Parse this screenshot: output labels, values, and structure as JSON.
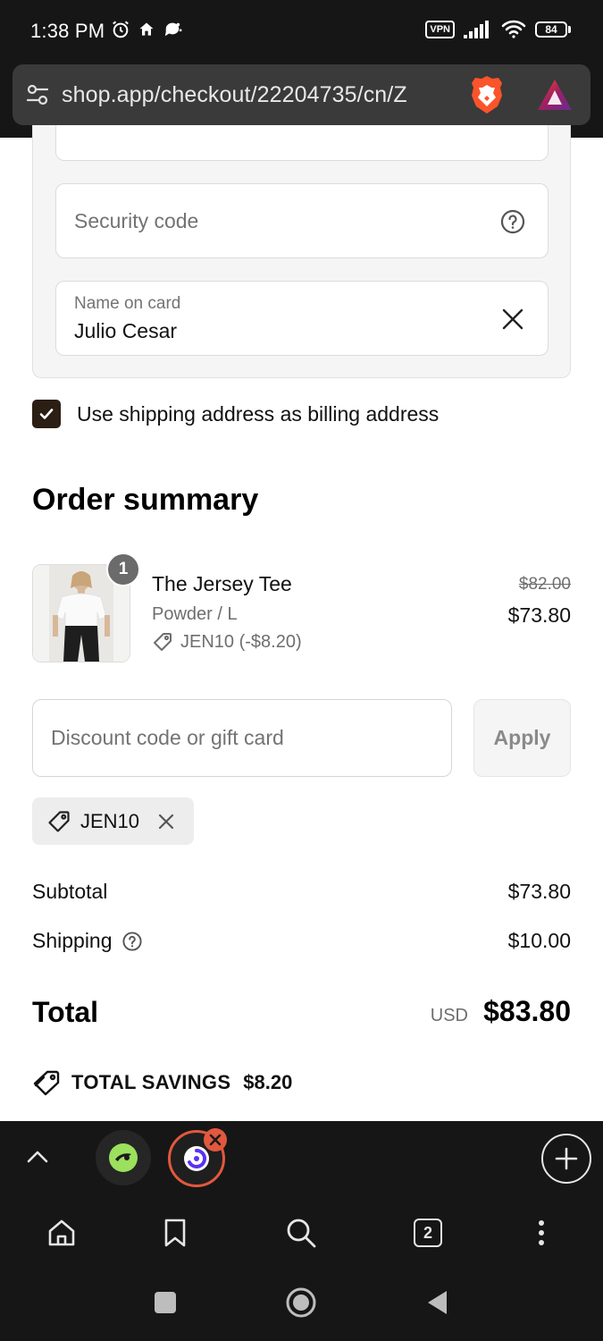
{
  "status_bar": {
    "time": "1:38 PM",
    "vpn_label": "VPN",
    "battery_level": "84"
  },
  "browser": {
    "url": "shop.app/checkout/22204735/cn/Z",
    "tabs_count": "2"
  },
  "payment_form": {
    "security_code_placeholder": "Security code",
    "name_label": "Name on card",
    "name_value": "Julio Cesar"
  },
  "billing": {
    "checkbox_checked": true,
    "checkbox_label": "Use shipping address as billing address"
  },
  "order_summary": {
    "title": "Order summary",
    "item": {
      "quantity": "1",
      "name": "The Jersey Tee",
      "variant": "Powder / L",
      "discount": "JEN10 (-$8.20)",
      "original_price": "$82.00",
      "final_price": "$73.80"
    },
    "discount_input_placeholder": "Discount code or gift card",
    "apply_label": "Apply",
    "applied_code": "JEN10",
    "subtotal_label": "Subtotal",
    "subtotal_value": "$73.80",
    "shipping_label": "Shipping",
    "shipping_value": "$10.00",
    "total_label": "Total",
    "total_currency": "USD",
    "total_value": "$83.80",
    "savings_label": "TOTAL SAVINGS",
    "savings_value": "$8.20"
  },
  "colors": {
    "checkbox_fill": "#2b1e14",
    "browser_chrome": "#161616",
    "active_tab_ring": "#e2583e"
  }
}
